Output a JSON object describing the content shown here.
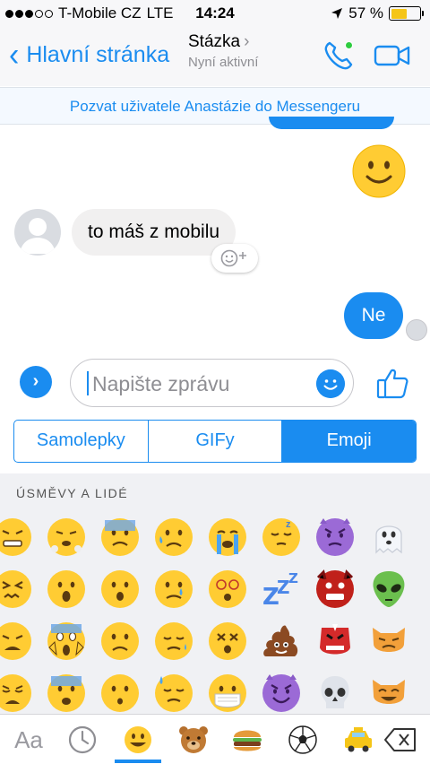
{
  "status_bar": {
    "carrier": "T-Mobile CZ",
    "network": "LTE",
    "time": "14:24",
    "battery": "57 %",
    "battery_level": 0.57,
    "signal_dots_filled": 3,
    "signal_dots_total": 5
  },
  "header": {
    "back_label": "Hlavní stránka",
    "contact_name": "Stázka",
    "contact_status": "Nyní aktivní"
  },
  "invite_banner": "Pozvat uživatele Anastázie do Messengeru",
  "messages": [
    {
      "direction": "out",
      "type": "emoji",
      "icon": "smiley-face-icon"
    },
    {
      "direction": "in",
      "type": "text",
      "text": "to máš z mobilu"
    },
    {
      "direction": "out",
      "type": "text",
      "text": "Ne"
    }
  ],
  "composer": {
    "placeholder": "Napište zprávu"
  },
  "picker_tabs": [
    {
      "label": "Samolepky",
      "active": false
    },
    {
      "label": "GIFy",
      "active": false
    },
    {
      "label": "Emoji",
      "active": true
    }
  ],
  "emoji_panel": {
    "section_title": "ÚSMĚVY A LIDÉ"
  },
  "bottom_bar": {
    "text_tab_label": "Aa",
    "tabs": [
      "keyboard-text",
      "recent-clock-icon",
      "smileys-icon",
      "animals-bear-icon",
      "food-burger-icon",
      "activity-soccer-icon",
      "travel-taxi-icon",
      "delete-backspace-icon"
    ]
  },
  "colors": {
    "accent": "#1a8cf0",
    "emoji_yellow": "#ffcc33",
    "online": "#2ecc40"
  }
}
